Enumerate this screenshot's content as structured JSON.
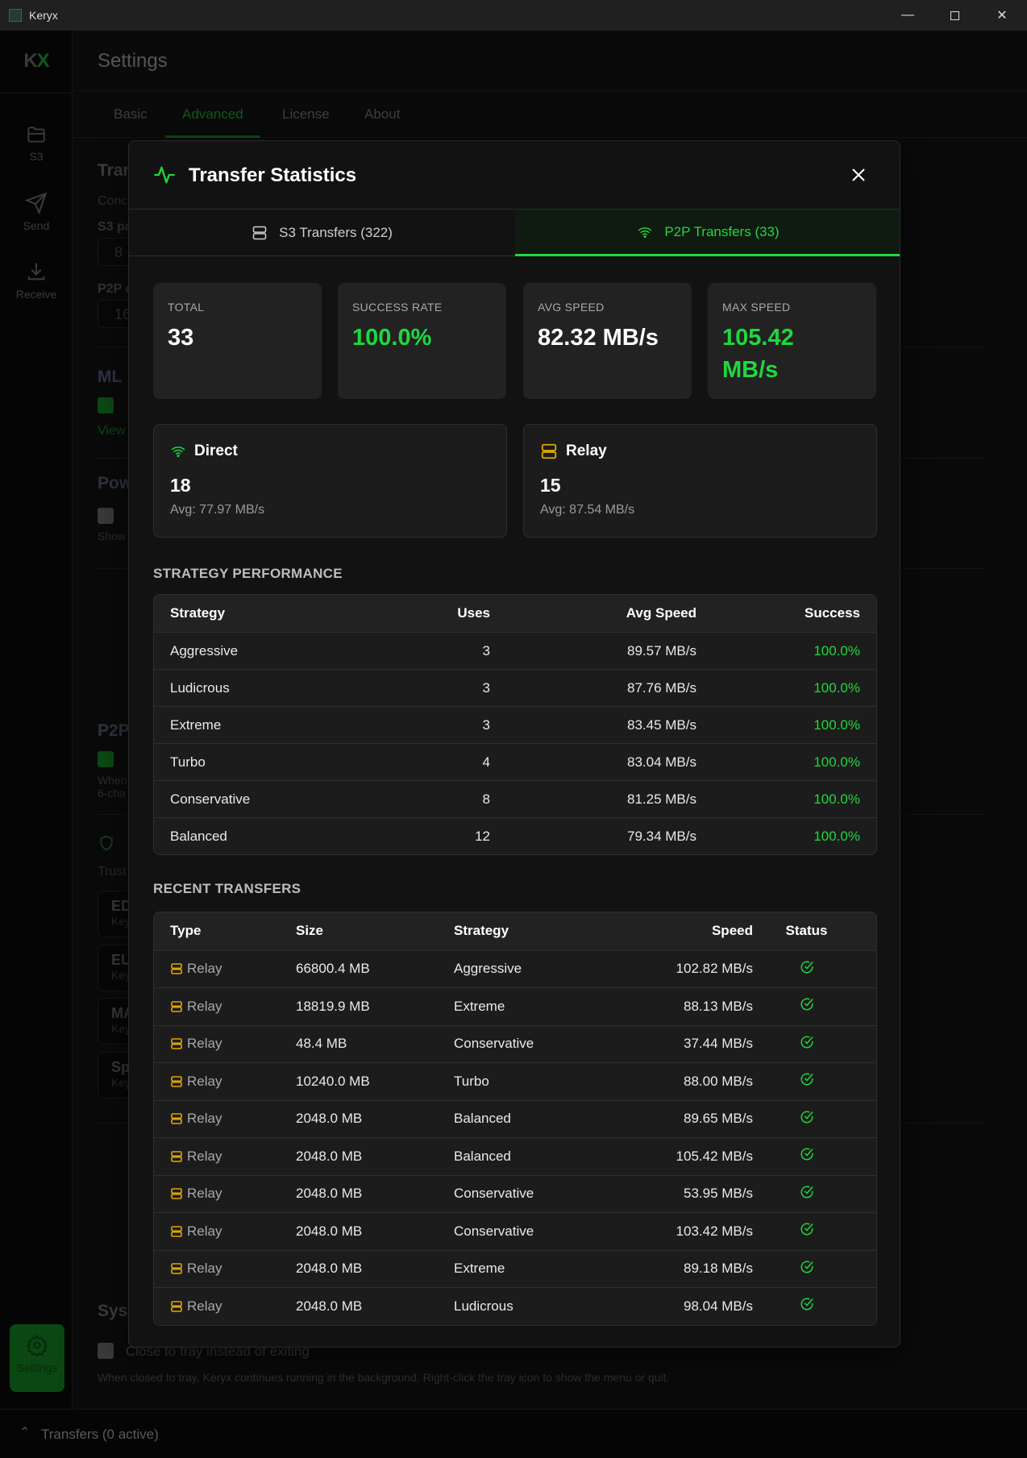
{
  "window": {
    "title": "Keryx",
    "controls": [
      "minimize",
      "maximize",
      "close"
    ]
  },
  "sidebar": {
    "logo_a": "K",
    "logo_b": "X",
    "items": [
      {
        "label": "S3",
        "icon": "folder-icon"
      },
      {
        "label": "Send",
        "icon": "send-icon"
      },
      {
        "label": "Receive",
        "icon": "download-icon"
      }
    ],
    "settings_label": "Settings"
  },
  "header": {
    "title": "Settings"
  },
  "settings_tabs": [
    {
      "label": "Basic"
    },
    {
      "label": "Advanced",
      "active": true
    },
    {
      "label": "License"
    },
    {
      "label": "About"
    }
  ],
  "background": {
    "transfer_heading": "Tran",
    "conc_label": "Conc",
    "s3_label": "S3 pa",
    "s3_value": "8",
    "p2p_label": "P2P c",
    "p2p_value": "16",
    "ml_heading": "ML",
    "ml_link": "View",
    "pow_heading": "Pow",
    "pow_desc": "Show",
    "p2p_heading": "P2P",
    "p2p_desc_1": "When",
    "p2p_desc_2": "6-cha",
    "trust_label": "Trust",
    "keys": [
      {
        "name": "ED",
        "sub": "Key"
      },
      {
        "name": "EU",
        "sub": "Key"
      },
      {
        "name": "MA",
        "sub": "Key"
      },
      {
        "name": "Sp",
        "sub": "Key"
      }
    ],
    "system_heading": "Syst",
    "tray_label": "Close to tray instead of exiting",
    "tray_desc": "When closed to tray, Keryx continues running in the background. Right-click the tray icon to show the menu or quit."
  },
  "bottom_bar": {
    "label": "Transfers (0 active)"
  },
  "modal": {
    "title": "Transfer Statistics",
    "tabs": [
      {
        "label": "S3 Transfers (322)",
        "icon": "server-icon"
      },
      {
        "label": "P2P Transfers (33)",
        "icon": "wifi-icon",
        "active": true
      }
    ],
    "stats": [
      {
        "label": "TOTAL",
        "value": "33"
      },
      {
        "label": "SUCCESS RATE",
        "value": "100.0%",
        "accent": true
      },
      {
        "label": "AVG SPEED",
        "value": "82.32 MB/s"
      },
      {
        "label": "MAX SPEED",
        "value": "105.42 MB/s",
        "accent": true
      }
    ],
    "modes": [
      {
        "name": "Direct",
        "icon": "wifi-icon",
        "count": "18",
        "avg": "Avg: 77.97 MB/s"
      },
      {
        "name": "Relay",
        "icon": "server-icon",
        "count": "15",
        "avg": "Avg: 87.54 MB/s"
      }
    ],
    "strategy_heading": "STRATEGY PERFORMANCE",
    "strategy_columns": [
      "Strategy",
      "Uses",
      "Avg Speed",
      "Success"
    ],
    "strategy_rows": [
      [
        "Aggressive",
        "3",
        "89.57 MB/s",
        "100.0%"
      ],
      [
        "Ludicrous",
        "3",
        "87.76 MB/s",
        "100.0%"
      ],
      [
        "Extreme",
        "3",
        "83.45 MB/s",
        "100.0%"
      ],
      [
        "Turbo",
        "4",
        "83.04 MB/s",
        "100.0%"
      ],
      [
        "Conservative",
        "8",
        "81.25 MB/s",
        "100.0%"
      ],
      [
        "Balanced",
        "12",
        "79.34 MB/s",
        "100.0%"
      ]
    ],
    "recent_heading": "RECENT TRANSFERS",
    "recent_columns": [
      "Type",
      "Size",
      "Strategy",
      "Speed",
      "Status"
    ],
    "recent_rows": [
      [
        "Relay",
        "66800.4 MB",
        "Aggressive",
        "102.82 MB/s",
        "success"
      ],
      [
        "Relay",
        "18819.9 MB",
        "Extreme",
        "88.13 MB/s",
        "success"
      ],
      [
        "Relay",
        "48.4 MB",
        "Conservative",
        "37.44 MB/s",
        "success"
      ],
      [
        "Relay",
        "10240.0 MB",
        "Turbo",
        "88.00 MB/s",
        "success"
      ],
      [
        "Relay",
        "2048.0 MB",
        "Balanced",
        "89.65 MB/s",
        "success"
      ],
      [
        "Relay",
        "2048.0 MB",
        "Balanced",
        "105.42 MB/s",
        "success"
      ],
      [
        "Relay",
        "2048.0 MB",
        "Conservative",
        "53.95 MB/s",
        "success"
      ],
      [
        "Relay",
        "2048.0 MB",
        "Conservative",
        "103.42 MB/s",
        "success"
      ],
      [
        "Relay",
        "2048.0 MB",
        "Extreme",
        "89.18 MB/s",
        "success"
      ],
      [
        "Relay",
        "2048.0 MB",
        "Ludicrous",
        "98.04 MB/s",
        "success"
      ]
    ]
  },
  "colors": {
    "accent": "#1fd83d",
    "relay": "#e0a800",
    "background": "#0a0a0a",
    "modal": "#121212",
    "card": "#222222"
  }
}
